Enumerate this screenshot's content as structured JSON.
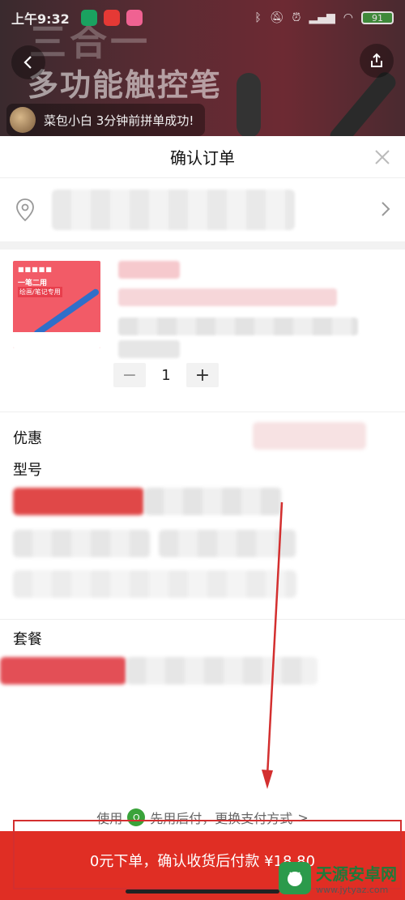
{
  "statusbar": {
    "time": "上午9:32",
    "battery": "91"
  },
  "hero": {
    "line1": "三合一",
    "line2": "多功能触控笔"
  },
  "notice": {
    "text": "菜包小白 3分钟前拼单成功!"
  },
  "sheet": {
    "title": "确认订单"
  },
  "product": {
    "thumb_line1": "一笔二用",
    "thumb_line2": "绘画/笔记专用",
    "quantity": "1",
    "minus": "−",
    "plus": "+"
  },
  "sections": {
    "discount_label": "优惠",
    "model_label": "型号",
    "package_label": "套餐"
  },
  "payment": {
    "prefix": "使用",
    "method": "先用后付，更换支付方式",
    "chevron": ">"
  },
  "bottom": {
    "button_label": "0元下单，确认收货后付款 ¥18.80"
  },
  "watermark": {
    "title": "天源安卓网",
    "url": "www.jytyaz.com"
  },
  "colors": {
    "accent": "#e02e24",
    "annotation": "#d32f2f",
    "pay_icon": "#3aa33a"
  }
}
